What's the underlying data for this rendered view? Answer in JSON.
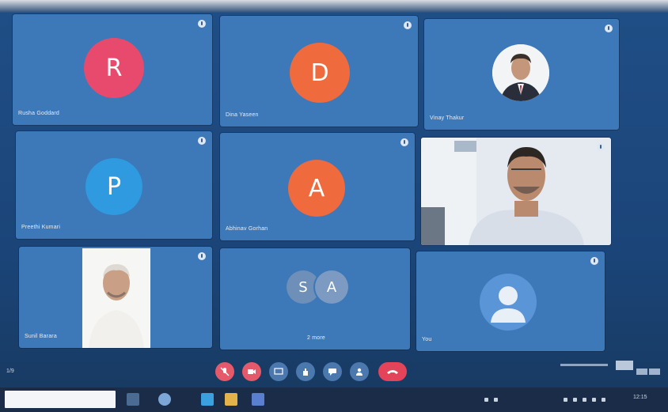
{
  "meeting": {
    "participants": [
      {
        "name": "Rusha Goddard",
        "initial": "R",
        "avatar_color": "#e84a6d",
        "kind": "initial"
      },
      {
        "name": "Dina Yaseen",
        "initial": "D",
        "avatar_color": "#ef6a3c",
        "kind": "initial"
      },
      {
        "name": "Vinay Thakur",
        "initial": "",
        "avatar_color": "",
        "kind": "photo"
      },
      {
        "name": "Preethi Kumari",
        "initial": "P",
        "avatar_color": "#2f9ae0",
        "kind": "initial"
      },
      {
        "name": "Abhinav Gorhan",
        "initial": "A",
        "avatar_color": "#ef6a3c",
        "kind": "initial"
      },
      {
        "name": "",
        "initial": "",
        "avatar_color": "",
        "kind": "video"
      },
      {
        "name": "Sunil Barara",
        "initial": "",
        "avatar_color": "",
        "kind": "photo"
      },
      {
        "name": "2 more",
        "initials": [
          "S",
          "A"
        ],
        "avatar_color": "#6e8fb8",
        "kind": "group"
      },
      {
        "name": "You",
        "initial": "",
        "avatar_color": "#5a95d8",
        "kind": "generic"
      }
    ]
  },
  "controls": {
    "status_text": "1/9",
    "buttons": [
      {
        "icon": "mic-off-icon",
        "color": "#e45a6a"
      },
      {
        "icon": "video-off-icon",
        "color": "#e45a6a"
      },
      {
        "icon": "share-screen-icon",
        "color": "#4b78ad"
      },
      {
        "icon": "raise-hand-icon",
        "color": "#4b78ad"
      },
      {
        "icon": "chat-icon",
        "color": "#4b78ad"
      },
      {
        "icon": "people-icon",
        "color": "#4b78ad"
      },
      {
        "icon": "more-options-icon",
        "color": "#4b78ad"
      },
      {
        "icon": "hang-up-icon",
        "color": "#e3445a"
      }
    ]
  },
  "taskbar": {
    "clock": "12:15"
  }
}
